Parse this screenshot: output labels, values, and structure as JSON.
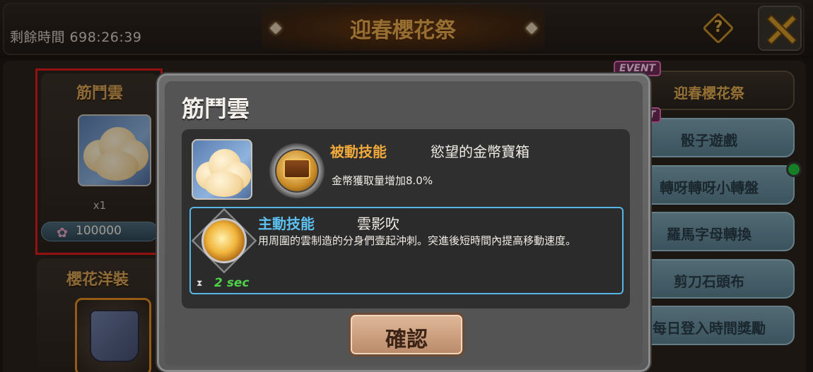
{
  "header": {
    "timer": "剩餘時間 698:26:39",
    "title": "迎春櫻花祭",
    "help_glyph": "?",
    "help_icon": "question-diamond-icon",
    "close_icon": "close-x-icon"
  },
  "shop_items": [
    {
      "name": "筋鬥雲",
      "quantity": "x1",
      "price": "100000",
      "currency_icon": "sakura-icon"
    },
    {
      "name": "櫻花洋裝"
    }
  ],
  "menu": {
    "event_tag": "EVENT",
    "items": [
      {
        "label": "迎春櫻花祭",
        "active": true
      },
      {
        "label": "骰子遊戲"
      },
      {
        "label": "轉呀轉呀小轉盤"
      },
      {
        "label": "羅馬字母轉換"
      },
      {
        "label": "剪刀石頭布"
      },
      {
        "label": "每日登入時間獎勵"
      }
    ]
  },
  "modal": {
    "title": "筋鬥雲",
    "passive": {
      "label": "被動技能",
      "name": "慾望的金幣寶箱",
      "description": "金幣獲取量增加8.0%"
    },
    "active": {
      "label": "主動技能",
      "name": "雲影吹",
      "description": "用周圍的雲制造的分身們壹起沖刺。突進後短時間內提高移動速度。",
      "cooldown": "2 sec"
    },
    "confirm_label": "確認"
  },
  "colors": {
    "title_gold": "#e8a94c",
    "passive_orange": "#f0a93a",
    "active_blue": "#5cc0f0",
    "cooldown_green": "#4fd14a",
    "highlight_red": "#e21b1b"
  }
}
